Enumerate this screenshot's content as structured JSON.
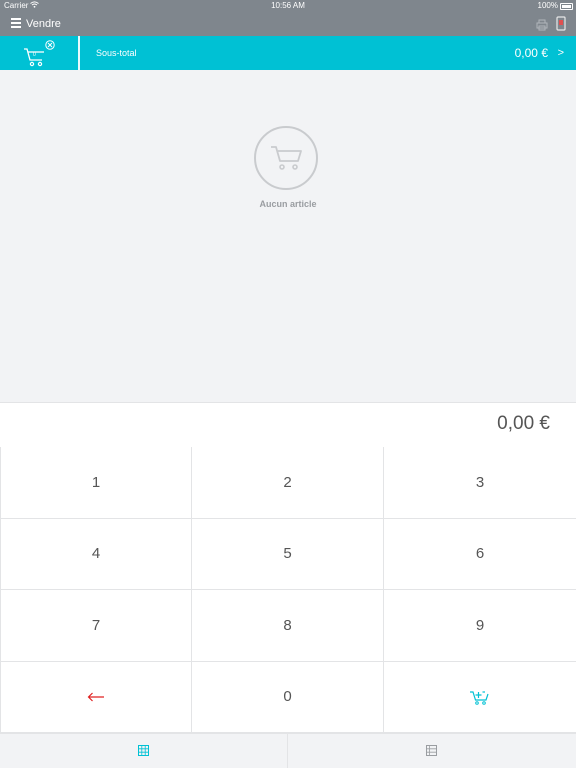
{
  "status_bar": {
    "carrier": "Carrier",
    "time": "10:56 AM",
    "battery": "100%"
  },
  "nav": {
    "title": "Vendre"
  },
  "cart_bar": {
    "subtotal_label": "Sous-total",
    "subtotal_value": "0,00 €",
    "chevron": ">"
  },
  "cart": {
    "empty_label": "Aucun article"
  },
  "amount": {
    "value": "0,00 €"
  },
  "keypad": {
    "keys": [
      "1",
      "2",
      "3",
      "4",
      "5",
      "6",
      "7",
      "8",
      "9"
    ],
    "backspace": "←",
    "zero": "0"
  },
  "colors": {
    "accent": "#00c1d4",
    "nav": "#7f868d",
    "backspace": "#e02020"
  },
  "icons": {
    "menu": "menu-icon",
    "printer": "printer-icon",
    "device": "device-icon",
    "cart": "cart-icon",
    "add_to_cart": "cart-add-icon",
    "grid": "grid-icon",
    "list": "list-icon"
  }
}
